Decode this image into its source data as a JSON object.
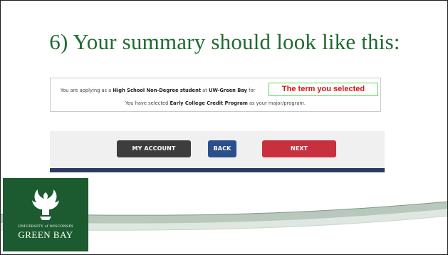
{
  "slide": {
    "title": "6) Your summary should look like this:"
  },
  "summary": {
    "line1_prefix": "You are applying as a ",
    "line1_role": "High School Non-Degree student",
    "line1_mid": " at ",
    "line1_campus": "UW-Green Bay",
    "line1_suffix": " for",
    "line2_prefix": "You have selected ",
    "line2_program": "Early College Credit Program",
    "line2_suffix": " as your major/program.",
    "term_callout": "The term you selected"
  },
  "buttons": {
    "my_account": "MY ACCOUNT",
    "back": "BACK",
    "next": "NEXT"
  },
  "logo": {
    "university_line": "UNIVERSITY of WISCONSIN",
    "name_line": "GREEN BAY"
  },
  "colors": {
    "title_green": "#1f6b2f",
    "brand_green": "#1b5b2f",
    "callout_red": "#e01010",
    "callout_border": "#5ad85a",
    "my_account_bg": "#3d3d3d",
    "back_bg": "#2b4f8c",
    "next_bg": "#c8303e"
  }
}
